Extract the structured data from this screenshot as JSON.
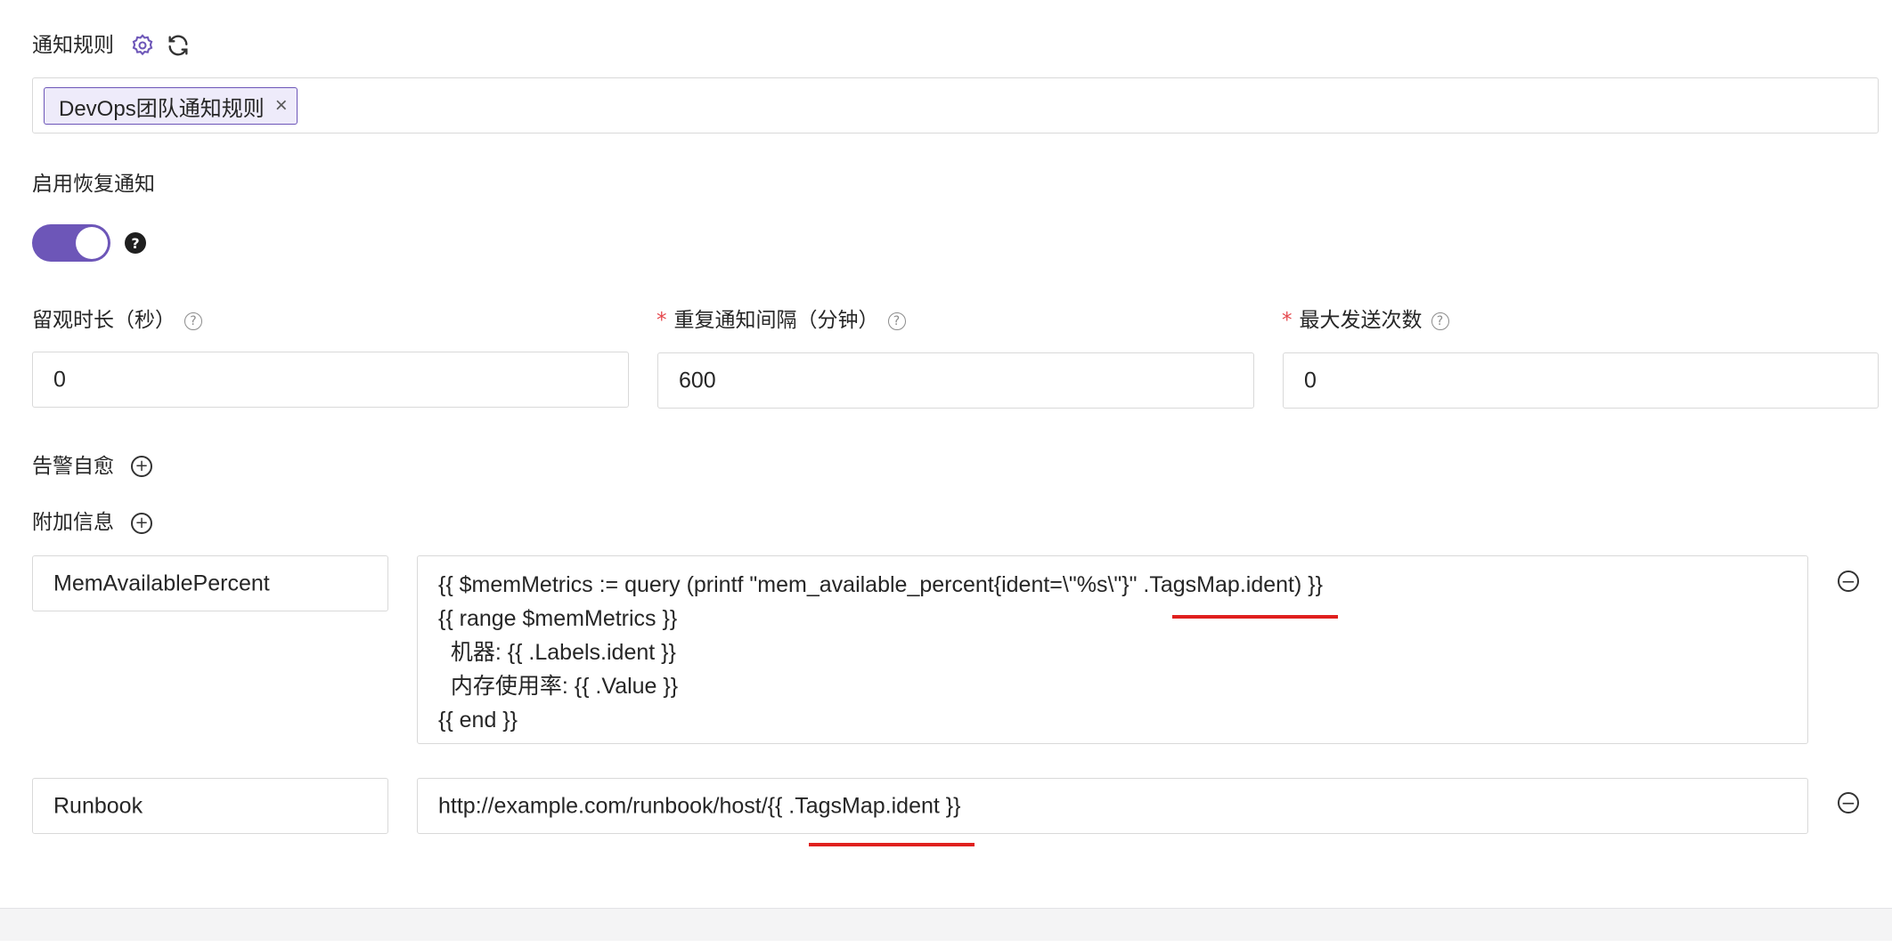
{
  "notify_rule": {
    "label": "通知规则",
    "tag": "DevOps团队通知规则",
    "tag_close": "×"
  },
  "recovery": {
    "label": "启用恢复通知",
    "enabled": true,
    "help": "?"
  },
  "observe": {
    "label": "留观时长（秒）",
    "value": "0"
  },
  "repeat": {
    "required_mark": "*",
    "label": "重复通知间隔（分钟）",
    "value": "600"
  },
  "max_send": {
    "required_mark": "*",
    "label": "最大发送次数",
    "value": "0"
  },
  "self_heal": {
    "label": "告警自愈"
  },
  "extra_info": {
    "label": "附加信息",
    "rows": [
      {
        "key": "MemAvailablePercent",
        "value_lines": [
          "{{ $memMetrics := query (printf \"mem_available_percent{ident=\\\"%s\\\"}\" .TagsMap.ident) }}",
          "{{ range $memMetrics }}",
          "  机器: {{ .Labels.ident }}",
          "  内存使用率: {{ .Value }}",
          "{{ end }}"
        ]
      },
      {
        "key": "Runbook",
        "value": "http://example.com/runbook/host/{{ .TagsMap.ident }}"
      }
    ]
  },
  "colors": {
    "accent": "#6d56b8",
    "required": "#e5484d",
    "underline": "#e0201e"
  }
}
